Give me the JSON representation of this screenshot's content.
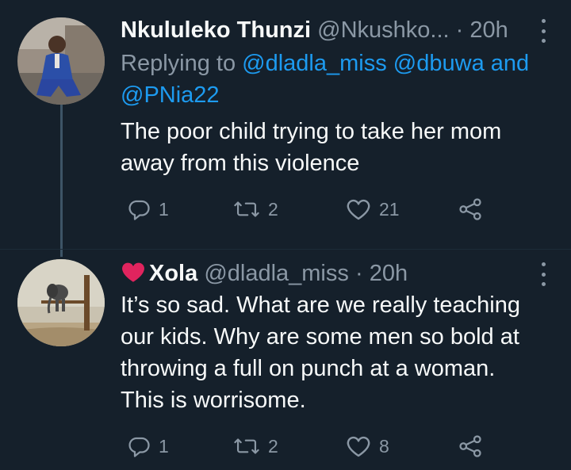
{
  "tweets": [
    {
      "display_name": "Nkululeko Thunzi",
      "handle": "@Nkushko...",
      "separator": "·",
      "time": "20h",
      "reply_prefix": "Replying to",
      "reply_mention_1": "@dladla_miss",
      "reply_mention_2": "@dbuwa",
      "reply_joiner": "and",
      "reply_mention_3": "@PNia22",
      "text_line_1": "The poor child trying to take her mom",
      "text_line_2": "away from this violence",
      "replies": "1",
      "retweets": "2",
      "likes": "21"
    },
    {
      "display_name": "Xola",
      "handle": "@dladla_miss",
      "separator": "·",
      "time": "20h",
      "text_line_1": "It’s so sad. What are we really teaching",
      "text_line_2": "our kids. Why are some men so bold at",
      "text_line_3": "throwing a full on punch at a woman.",
      "text_line_4": "This is worrisome.",
      "replies": "1",
      "retweets": "2",
      "likes": "8"
    }
  ],
  "colors": {
    "background": "#15202b",
    "text": "#f7f9f9",
    "secondary": "#8b98a5",
    "mention": "#1d9bf0",
    "heart_emoji": "#e0245e"
  },
  "icons": [
    "reply-icon",
    "retweet-icon",
    "like-icon",
    "share-icon",
    "more-icon",
    "red-heart-emoji"
  ]
}
